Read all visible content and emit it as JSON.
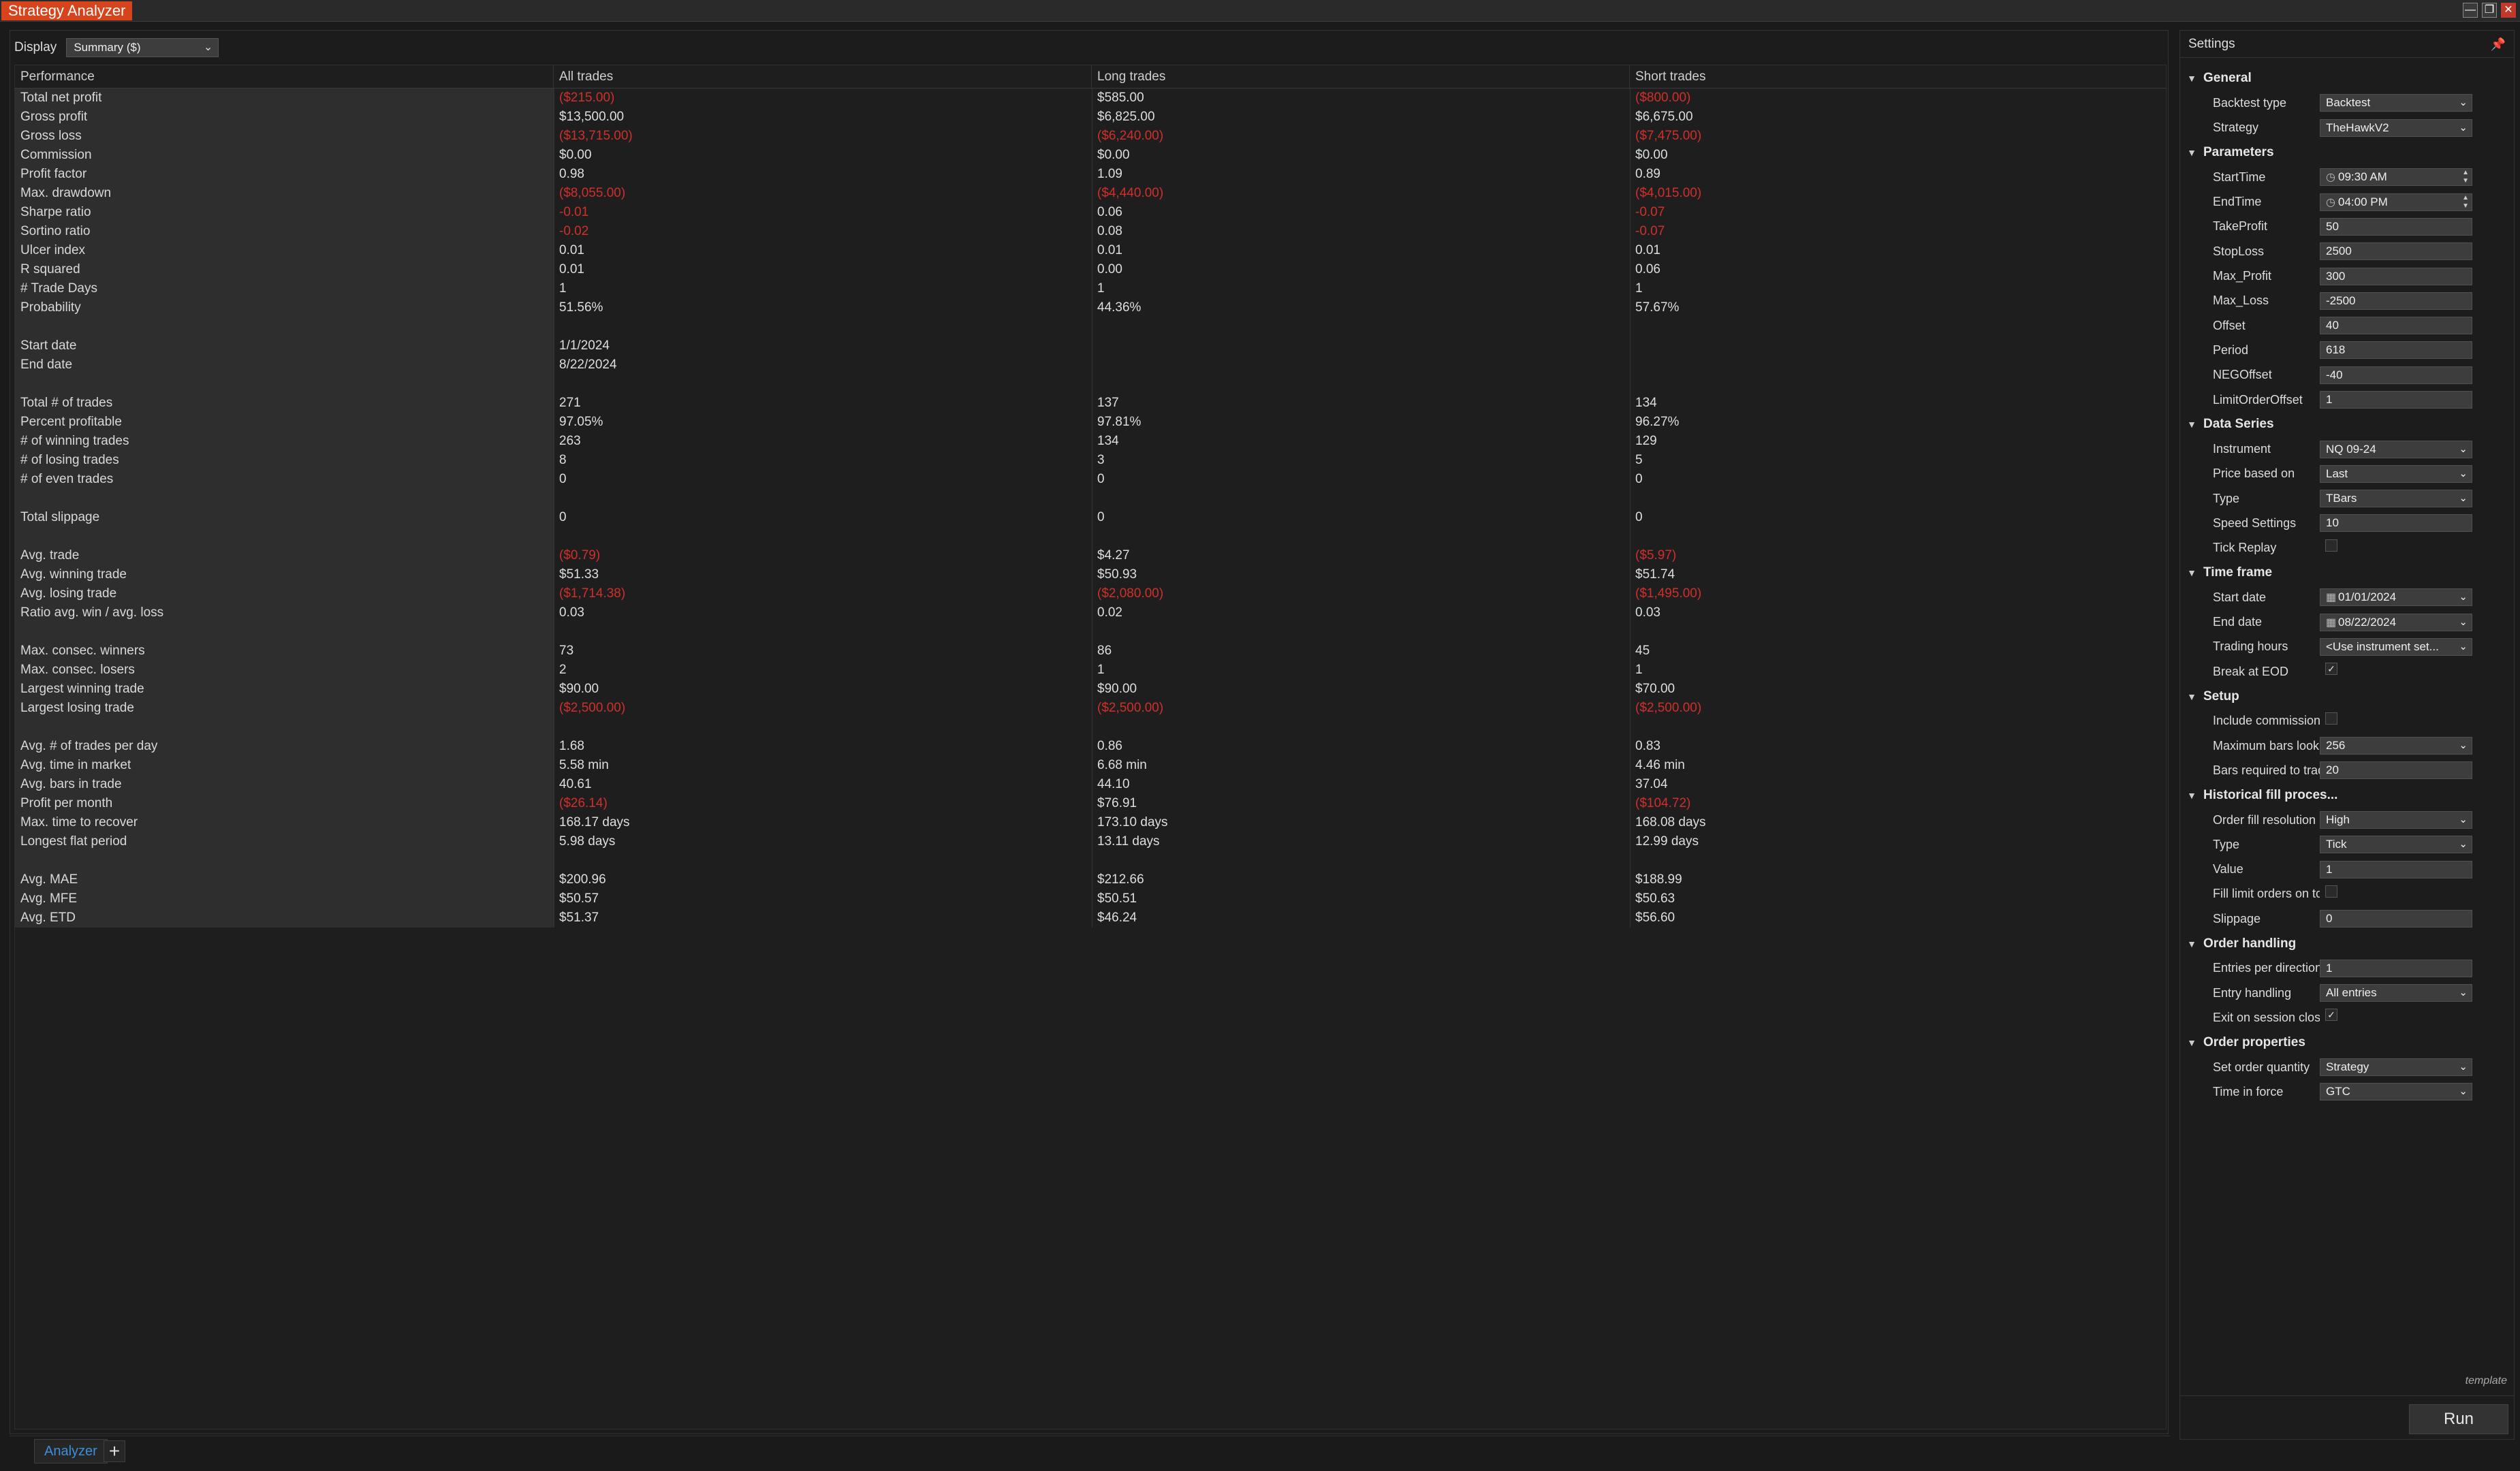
{
  "window": {
    "title": "Strategy Analyzer",
    "min": "—",
    "restore": "❐",
    "close": "✕"
  },
  "display": {
    "label": "Display",
    "value": "Summary ($)"
  },
  "table": {
    "headers": [
      "Performance",
      "All trades",
      "Long trades",
      "Short trades"
    ],
    "rows": [
      {
        "label": "Total net profit",
        "values": [
          "($215.00)",
          "$585.00",
          "($800.00)"
        ],
        "neg": [
          true,
          false,
          true
        ]
      },
      {
        "label": "Gross profit",
        "values": [
          "$13,500.00",
          "$6,825.00",
          "$6,675.00"
        ],
        "neg": [
          false,
          false,
          false
        ]
      },
      {
        "label": "Gross loss",
        "values": [
          "($13,715.00)",
          "($6,240.00)",
          "($7,475.00)"
        ],
        "neg": [
          true,
          true,
          true
        ]
      },
      {
        "label": "Commission",
        "values": [
          "$0.00",
          "$0.00",
          "$0.00"
        ],
        "neg": [
          false,
          false,
          false
        ]
      },
      {
        "label": "Profit factor",
        "values": [
          "0.98",
          "1.09",
          "0.89"
        ],
        "neg": [
          false,
          false,
          false
        ]
      },
      {
        "label": "Max. drawdown",
        "values": [
          "($8,055.00)",
          "($4,440.00)",
          "($4,015.00)"
        ],
        "neg": [
          true,
          true,
          true
        ]
      },
      {
        "label": "Sharpe ratio",
        "values": [
          "-0.01",
          "0.06",
          "-0.07"
        ],
        "neg": [
          true,
          false,
          true
        ]
      },
      {
        "label": "Sortino ratio",
        "values": [
          "-0.02",
          "0.08",
          "-0.07"
        ],
        "neg": [
          true,
          false,
          true
        ]
      },
      {
        "label": "Ulcer index",
        "values": [
          "0.01",
          "0.01",
          "0.01"
        ],
        "neg": [
          false,
          false,
          false
        ]
      },
      {
        "label": "R squared",
        "values": [
          "0.01",
          "0.00",
          "0.06"
        ],
        "neg": [
          false,
          false,
          false
        ]
      },
      {
        "label": "# Trade Days",
        "values": [
          "1",
          "1",
          "1"
        ],
        "neg": [
          false,
          false,
          false
        ]
      },
      {
        "label": "Probability",
        "values": [
          "51.56%",
          "44.36%",
          "57.67%"
        ],
        "neg": [
          false,
          false,
          false
        ]
      },
      {
        "label": "",
        "values": [
          "",
          "",
          ""
        ],
        "neg": [
          false,
          false,
          false
        ]
      },
      {
        "label": "Start date",
        "values": [
          "1/1/2024",
          "",
          ""
        ],
        "neg": [
          false,
          false,
          false
        ]
      },
      {
        "label": "End date",
        "values": [
          "8/22/2024",
          "",
          ""
        ],
        "neg": [
          false,
          false,
          false
        ]
      },
      {
        "label": "",
        "values": [
          "",
          "",
          ""
        ],
        "neg": [
          false,
          false,
          false
        ]
      },
      {
        "label": "Total # of trades",
        "values": [
          "271",
          "137",
          "134"
        ],
        "neg": [
          false,
          false,
          false
        ]
      },
      {
        "label": "Percent profitable",
        "values": [
          "97.05%",
          "97.81%",
          "96.27%"
        ],
        "neg": [
          false,
          false,
          false
        ]
      },
      {
        "label": "# of winning trades",
        "values": [
          "263",
          "134",
          "129"
        ],
        "neg": [
          false,
          false,
          false
        ]
      },
      {
        "label": "# of losing trades",
        "values": [
          "8",
          "3",
          "5"
        ],
        "neg": [
          false,
          false,
          false
        ]
      },
      {
        "label": "# of even trades",
        "values": [
          "0",
          "0",
          "0"
        ],
        "neg": [
          false,
          false,
          false
        ]
      },
      {
        "label": "",
        "values": [
          "",
          "",
          ""
        ],
        "neg": [
          false,
          false,
          false
        ]
      },
      {
        "label": "Total slippage",
        "values": [
          "0",
          "0",
          "0"
        ],
        "neg": [
          false,
          false,
          false
        ]
      },
      {
        "label": "",
        "values": [
          "",
          "",
          ""
        ],
        "neg": [
          false,
          false,
          false
        ]
      },
      {
        "label": "Avg. trade",
        "values": [
          "($0.79)",
          "$4.27",
          "($5.97)"
        ],
        "neg": [
          true,
          false,
          true
        ]
      },
      {
        "label": "Avg. winning trade",
        "values": [
          "$51.33",
          "$50.93",
          "$51.74"
        ],
        "neg": [
          false,
          false,
          false
        ]
      },
      {
        "label": "Avg. losing trade",
        "values": [
          "($1,714.38)",
          "($2,080.00)",
          "($1,495.00)"
        ],
        "neg": [
          true,
          true,
          true
        ]
      },
      {
        "label": "Ratio avg. win / avg. loss",
        "values": [
          "0.03",
          "0.02",
          "0.03"
        ],
        "neg": [
          false,
          false,
          false
        ]
      },
      {
        "label": "",
        "values": [
          "",
          "",
          ""
        ],
        "neg": [
          false,
          false,
          false
        ]
      },
      {
        "label": "Max. consec. winners",
        "values": [
          "73",
          "86",
          "45"
        ],
        "neg": [
          false,
          false,
          false
        ]
      },
      {
        "label": "Max. consec. losers",
        "values": [
          "2",
          "1",
          "1"
        ],
        "neg": [
          false,
          false,
          false
        ]
      },
      {
        "label": "Largest winning trade",
        "values": [
          "$90.00",
          "$90.00",
          "$70.00"
        ],
        "neg": [
          false,
          false,
          false
        ]
      },
      {
        "label": "Largest losing trade",
        "values": [
          "($2,500.00)",
          "($2,500.00)",
          "($2,500.00)"
        ],
        "neg": [
          true,
          true,
          true
        ]
      },
      {
        "label": "",
        "values": [
          "",
          "",
          ""
        ],
        "neg": [
          false,
          false,
          false
        ]
      },
      {
        "label": "Avg. # of trades per day",
        "values": [
          "1.68",
          "0.86",
          "0.83"
        ],
        "neg": [
          false,
          false,
          false
        ]
      },
      {
        "label": "Avg. time in market",
        "values": [
          "5.58 min",
          "6.68 min",
          "4.46 min"
        ],
        "neg": [
          false,
          false,
          false
        ]
      },
      {
        "label": "Avg. bars in trade",
        "values": [
          "40.61",
          "44.10",
          "37.04"
        ],
        "neg": [
          false,
          false,
          false
        ]
      },
      {
        "label": "Profit per month",
        "values": [
          "($26.14)",
          "$76.91",
          "($104.72)"
        ],
        "neg": [
          true,
          false,
          true
        ]
      },
      {
        "label": "Max. time to recover",
        "values": [
          "168.17 days",
          "173.10 days",
          "168.08 days"
        ],
        "neg": [
          false,
          false,
          false
        ]
      },
      {
        "label": "Longest flat period",
        "values": [
          "5.98 days",
          "13.11 days",
          "12.99 days"
        ],
        "neg": [
          false,
          false,
          false
        ]
      },
      {
        "label": "",
        "values": [
          "",
          "",
          ""
        ],
        "neg": [
          false,
          false,
          false
        ]
      },
      {
        "label": "Avg. MAE",
        "values": [
          "$200.96",
          "$212.66",
          "$188.99"
        ],
        "neg": [
          false,
          false,
          false
        ]
      },
      {
        "label": "Avg. MFE",
        "values": [
          "$50.57",
          "$50.51",
          "$50.63"
        ],
        "neg": [
          false,
          false,
          false
        ]
      },
      {
        "label": "Avg. ETD",
        "values": [
          "$51.37",
          "$46.24",
          "$56.60"
        ],
        "neg": [
          false,
          false,
          false
        ]
      }
    ]
  },
  "tabs": {
    "active": "Analyzer",
    "add": "+"
  },
  "settings": {
    "title": "Settings",
    "pin_icon": "pin-icon",
    "template_label": "template",
    "run_label": "Run",
    "sections": [
      {
        "title": "General",
        "props": [
          {
            "name": "Backtest type",
            "value": "Backtest",
            "kind": "select"
          },
          {
            "name": "Strategy",
            "value": "TheHawkV2",
            "kind": "select"
          }
        ]
      },
      {
        "title": "Parameters",
        "props": [
          {
            "name": "StartTime",
            "value": "09:30 AM",
            "kind": "time"
          },
          {
            "name": "EndTime",
            "value": "04:00 PM",
            "kind": "time"
          },
          {
            "name": "TakeProfit",
            "value": "50",
            "kind": "text"
          },
          {
            "name": "StopLoss",
            "value": "2500",
            "kind": "text"
          },
          {
            "name": "Max_Profit",
            "value": "300",
            "kind": "text"
          },
          {
            "name": "Max_Loss",
            "value": "-2500",
            "kind": "text"
          },
          {
            "name": "Offset",
            "value": "40",
            "kind": "text"
          },
          {
            "name": "Period",
            "value": "618",
            "kind": "text"
          },
          {
            "name": "NEGOffset",
            "value": "-40",
            "kind": "text"
          },
          {
            "name": "LimitOrderOffset",
            "value": "1",
            "kind": "text"
          }
        ]
      },
      {
        "title": "Data Series",
        "props": [
          {
            "name": "Instrument",
            "value": "NQ 09-24",
            "kind": "select"
          },
          {
            "name": "Price based on",
            "value": "Last",
            "kind": "select"
          },
          {
            "name": "Type",
            "value": "TBars",
            "kind": "select"
          },
          {
            "name": "Speed Settings",
            "value": "10",
            "kind": "text"
          },
          {
            "name": "Tick Replay",
            "value": "",
            "kind": "check",
            "checked": false
          }
        ]
      },
      {
        "title": "Time frame",
        "props": [
          {
            "name": "Start date",
            "value": "01/01/2024",
            "kind": "date"
          },
          {
            "name": "End date",
            "value": "08/22/2024",
            "kind": "date"
          },
          {
            "name": "Trading hours",
            "value": "<Use instrument set...",
            "kind": "select"
          },
          {
            "name": "Break at EOD",
            "value": "",
            "kind": "check",
            "checked": true
          }
        ]
      },
      {
        "title": "Setup",
        "props": [
          {
            "name": "Include commission",
            "value": "",
            "kind": "check",
            "checked": false
          },
          {
            "name": "Maximum bars look b...",
            "value": "256",
            "kind": "select"
          },
          {
            "name": "Bars required to trade",
            "value": "20",
            "kind": "text"
          }
        ]
      },
      {
        "title": "Historical fill proces...",
        "props": [
          {
            "name": "Order fill resolution",
            "value": "High",
            "kind": "select"
          },
          {
            "name": "Type",
            "value": "Tick",
            "kind": "select"
          },
          {
            "name": "Value",
            "value": "1",
            "kind": "text"
          },
          {
            "name": "Fill limit orders on to...",
            "value": "",
            "kind": "check",
            "checked": false
          },
          {
            "name": "Slippage",
            "value": "0",
            "kind": "text"
          }
        ]
      },
      {
        "title": "Order handling",
        "props": [
          {
            "name": "Entries per direction",
            "value": "1",
            "kind": "text"
          },
          {
            "name": "Entry handling",
            "value": "All entries",
            "kind": "select"
          },
          {
            "name": "Exit on session close",
            "value": "",
            "kind": "check",
            "checked": true
          }
        ]
      },
      {
        "title": "Order properties",
        "props": [
          {
            "name": "Set order quantity",
            "value": "Strategy",
            "kind": "select"
          },
          {
            "name": "Time in force",
            "value": "GTC",
            "kind": "select"
          }
        ]
      }
    ]
  }
}
